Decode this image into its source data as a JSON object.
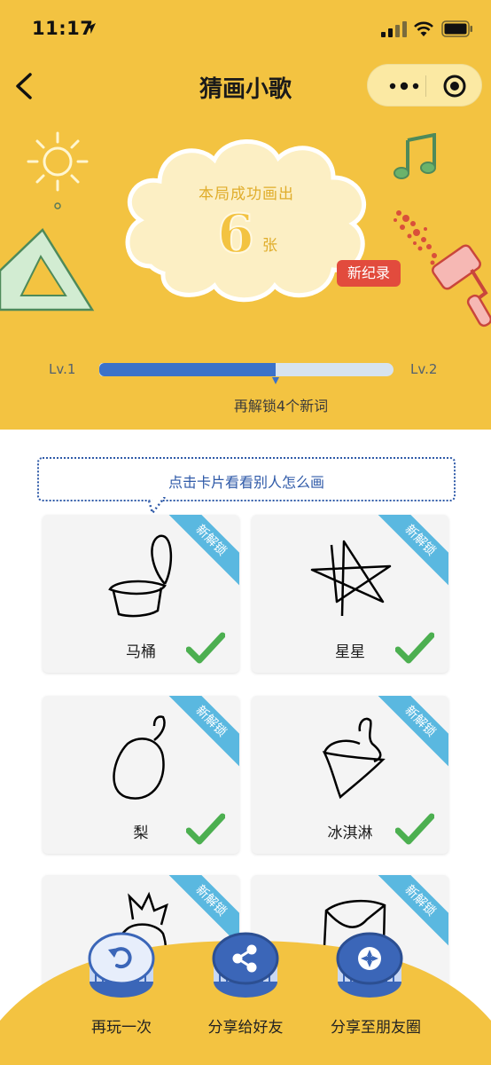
{
  "status_bar": {
    "time": "11:17"
  },
  "nav": {
    "title": "猜画小歌"
  },
  "result": {
    "success_label": "本局成功画出",
    "count": "6",
    "unit": "张",
    "record_badge": "新纪录"
  },
  "level": {
    "from": "Lv.1",
    "to": "Lv.2",
    "progress_fraction": 0.6,
    "hint": "再解锁4个新词"
  },
  "tip": "点击卡片看看别人怎么画",
  "cards": [
    {
      "word": "马桶",
      "badge": "新解锁",
      "solved": true
    },
    {
      "word": "星星",
      "badge": "新解锁",
      "solved": true
    },
    {
      "word": "梨",
      "badge": "新解锁",
      "solved": true
    },
    {
      "word": "冰淇淋",
      "badge": "新解锁",
      "solved": true
    },
    {
      "word": "",
      "badge": "新解锁",
      "solved": false
    },
    {
      "word": "",
      "badge": "新解锁",
      "solved": false
    }
  ],
  "actions": [
    {
      "label": "再玩一次",
      "icon": "replay-icon"
    },
    {
      "label": "分享给好友",
      "icon": "share-icon"
    },
    {
      "label": "分享至朋友圈",
      "icon": "moments-icon"
    }
  ],
  "colors": {
    "header_yellow": "#f3c341",
    "progress_blue": "#3b72c9",
    "badge_red": "#e24b3d",
    "ribbon_blue": "#5ab8e0",
    "check_green": "#4caf50"
  }
}
